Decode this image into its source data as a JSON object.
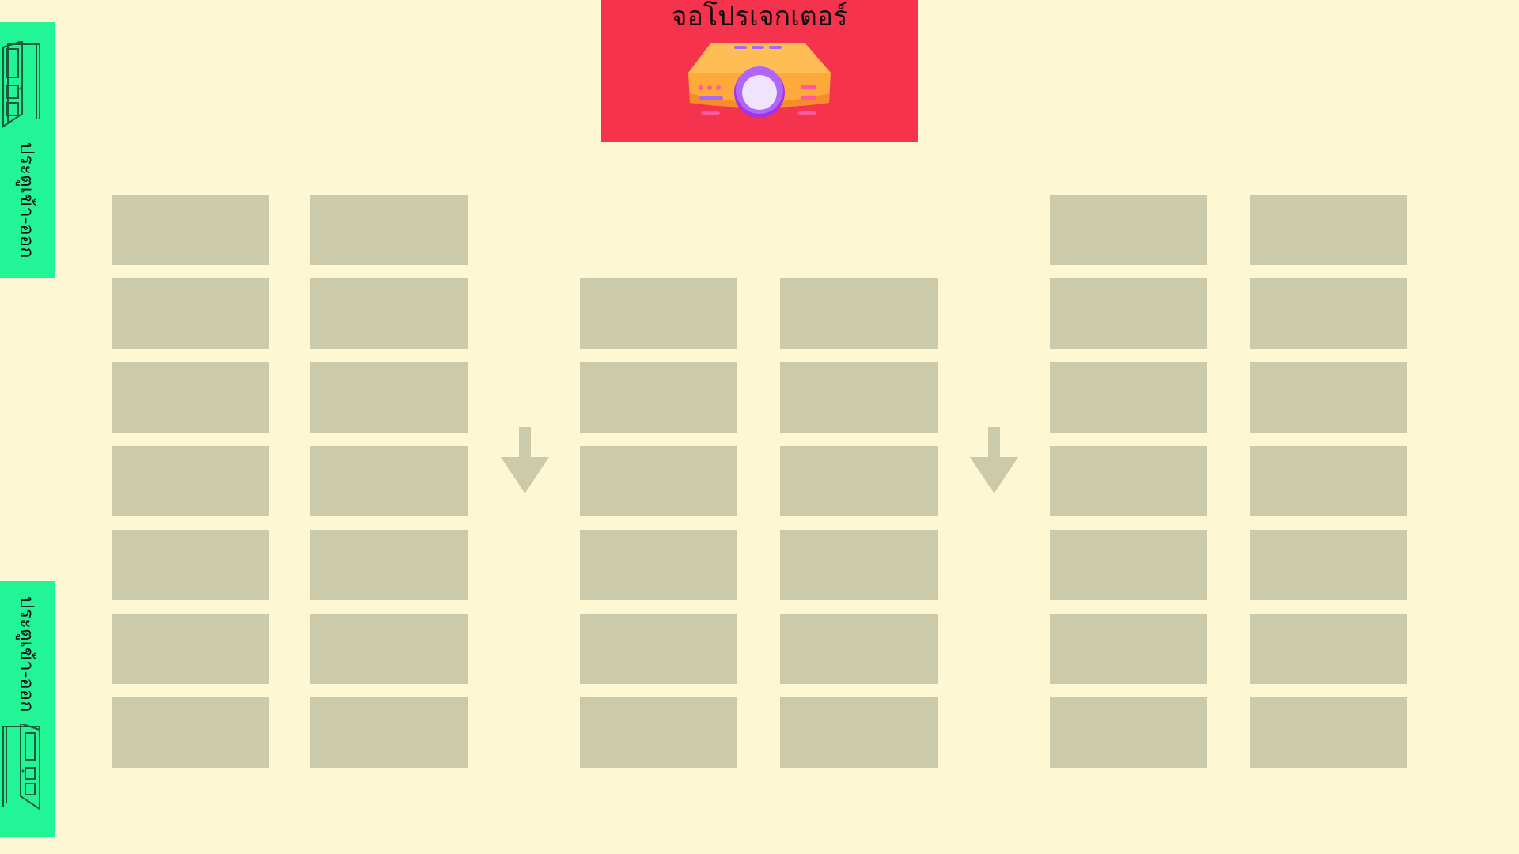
{
  "screen": {
    "title": "จอโปรเจกเตอร์",
    "icon": "projector-icon",
    "color": "#f5334c"
  },
  "doors": [
    {
      "label": "ประตูเข้า-ออก",
      "icon": "door-icon",
      "position": "top"
    },
    {
      "label": "ประตูเข้า-ออก",
      "icon": "door-icon",
      "position": "bottom"
    }
  ],
  "seating": {
    "seat_color": "#cbcaaa",
    "columns": [
      {
        "group": "left",
        "seats": 7
      },
      {
        "group": "left",
        "seats": 7
      },
      {
        "group": "center",
        "seats": 6
      },
      {
        "group": "center",
        "seats": 6
      },
      {
        "group": "right",
        "seats": 7
      },
      {
        "group": "right",
        "seats": 7
      }
    ],
    "aisle_arrows": [
      "arrow-down-icon",
      "arrow-down-icon"
    ]
  }
}
